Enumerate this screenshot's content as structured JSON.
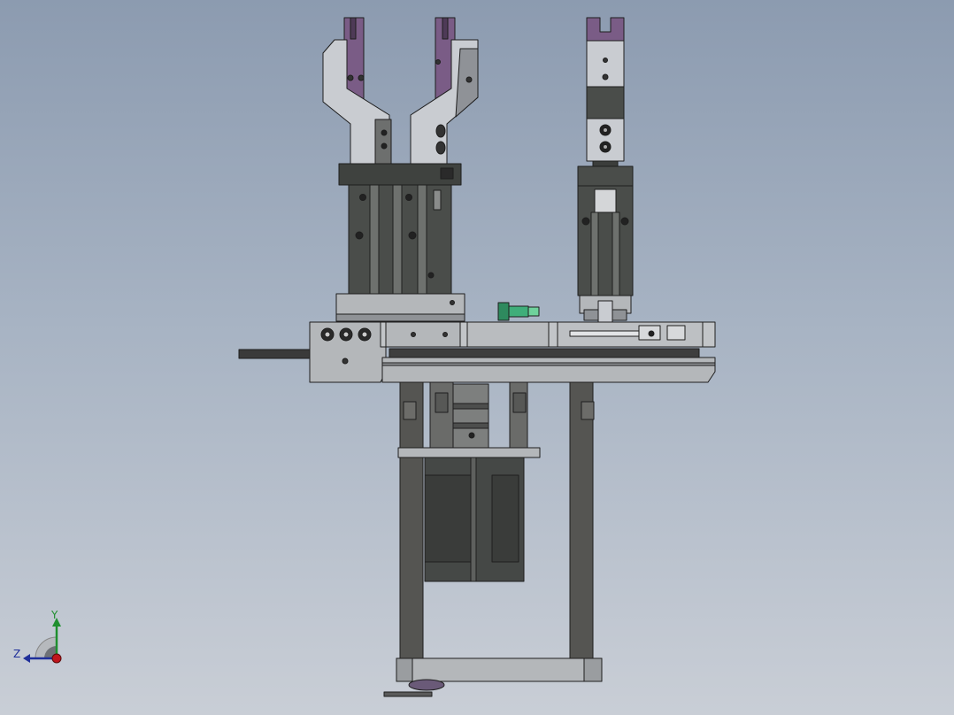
{
  "view": {
    "background_top": "#8c9bb0",
    "background_bottom": "#c9ced6",
    "model": "gripper-assembly"
  },
  "colors": {
    "jaw_purple": "#7a5c86",
    "jaw_gray": "#c9ccd1",
    "cylinder_dark": "#4a4d4a",
    "plate_gray": "#b4b7ba",
    "column_dark": "#555552",
    "fitting_green": "#3fae7a"
  },
  "triad": {
    "y_label": "Y",
    "z_label": "Z",
    "y_color": "#1f8f2f",
    "z_color": "#1f2f9a",
    "x_color": "#c0151c",
    "icon": "coordinate-triad-icon"
  }
}
